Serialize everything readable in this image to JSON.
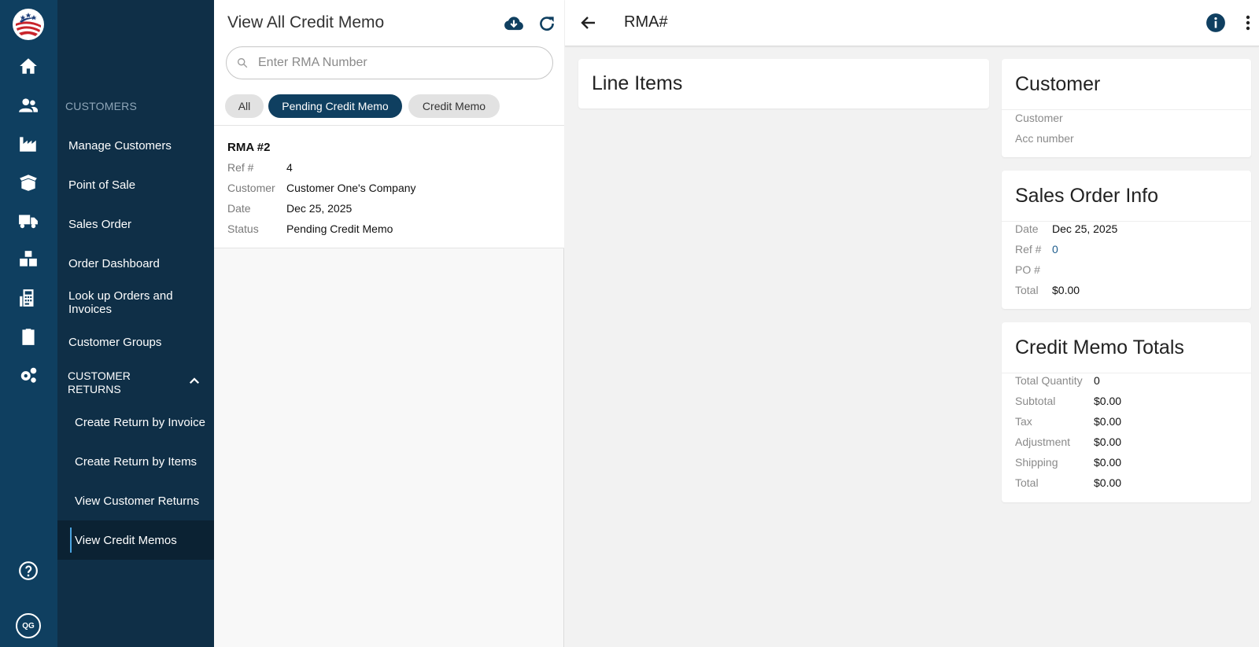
{
  "nav": {
    "section_label": "CUSTOMERS",
    "items": [
      {
        "label": "Manage Customers"
      },
      {
        "label": "Point of Sale"
      },
      {
        "label": "Sales Order"
      },
      {
        "label": "Order Dashboard"
      },
      {
        "label": "Look up Orders and Invoices"
      },
      {
        "label": "Customer Groups"
      }
    ],
    "group_label": "CUSTOMER RETURNS",
    "sub_items": [
      {
        "label": "Create Return by Invoice"
      },
      {
        "label": "Create Return by Items"
      },
      {
        "label": "View Customer Returns"
      },
      {
        "label": "View Credit Memos"
      }
    ],
    "avatar_initials": "QG"
  },
  "list": {
    "title": "View All Credit Memo",
    "search_placeholder": "Enter RMA Number",
    "chips": [
      {
        "label": "All",
        "active": false
      },
      {
        "label": "Pending Credit Memo",
        "active": true
      },
      {
        "label": "Credit Memo",
        "active": false
      }
    ],
    "records": [
      {
        "rma": "RMA #2",
        "fields": [
          {
            "key": "Ref #",
            "value": "4"
          },
          {
            "key": "Customer",
            "value": "Customer One's Company"
          },
          {
            "key": "Date",
            "value": "Dec 25, 2025"
          },
          {
            "key": "Status",
            "value": "Pending Credit Memo"
          }
        ]
      }
    ]
  },
  "detail": {
    "header_title": "RMA#",
    "line_items_title": "Line Items",
    "customer": {
      "title": "Customer",
      "fields": [
        {
          "key": "Customer",
          "value": ""
        },
        {
          "key": "Acc number",
          "value": ""
        }
      ]
    },
    "sales_order": {
      "title": "Sales Order Info",
      "fields": [
        {
          "key": "Date",
          "value": "Dec 25, 2025"
        },
        {
          "key": "Ref #",
          "value": "0"
        },
        {
          "key": "PO #",
          "value": ""
        },
        {
          "key": "Total",
          "value": "$0.00"
        }
      ]
    },
    "totals": {
      "title": "Credit Memo Totals",
      "fields": [
        {
          "key": "Total Quantity",
          "value": "0"
        },
        {
          "key": "Subtotal",
          "value": "$0.00"
        },
        {
          "key": "Tax",
          "value": "$0.00"
        },
        {
          "key": "Adjustment",
          "value": "$0.00"
        },
        {
          "key": "Shipping",
          "value": "$0.00"
        },
        {
          "key": "Total",
          "value": "$0.00"
        }
      ]
    }
  },
  "colors": {
    "rail": "#0f3f60",
    "nav": "#0f2f47",
    "accent": "#0f3f60",
    "link": "#1d5c8c"
  },
  "icons": {
    "rail": [
      "home-icon",
      "users-icon",
      "factory-icon",
      "open-box-icon",
      "delivery-truck-icon",
      "boxes-icon",
      "calculator-icon",
      "clipboard-icon",
      "gears-icon",
      "help-icon"
    ],
    "list_header": [
      "cloud-download-icon",
      "refresh-icon"
    ],
    "detail_header": [
      "back-arrow-icon",
      "info-icon",
      "more-vert-icon"
    ]
  }
}
